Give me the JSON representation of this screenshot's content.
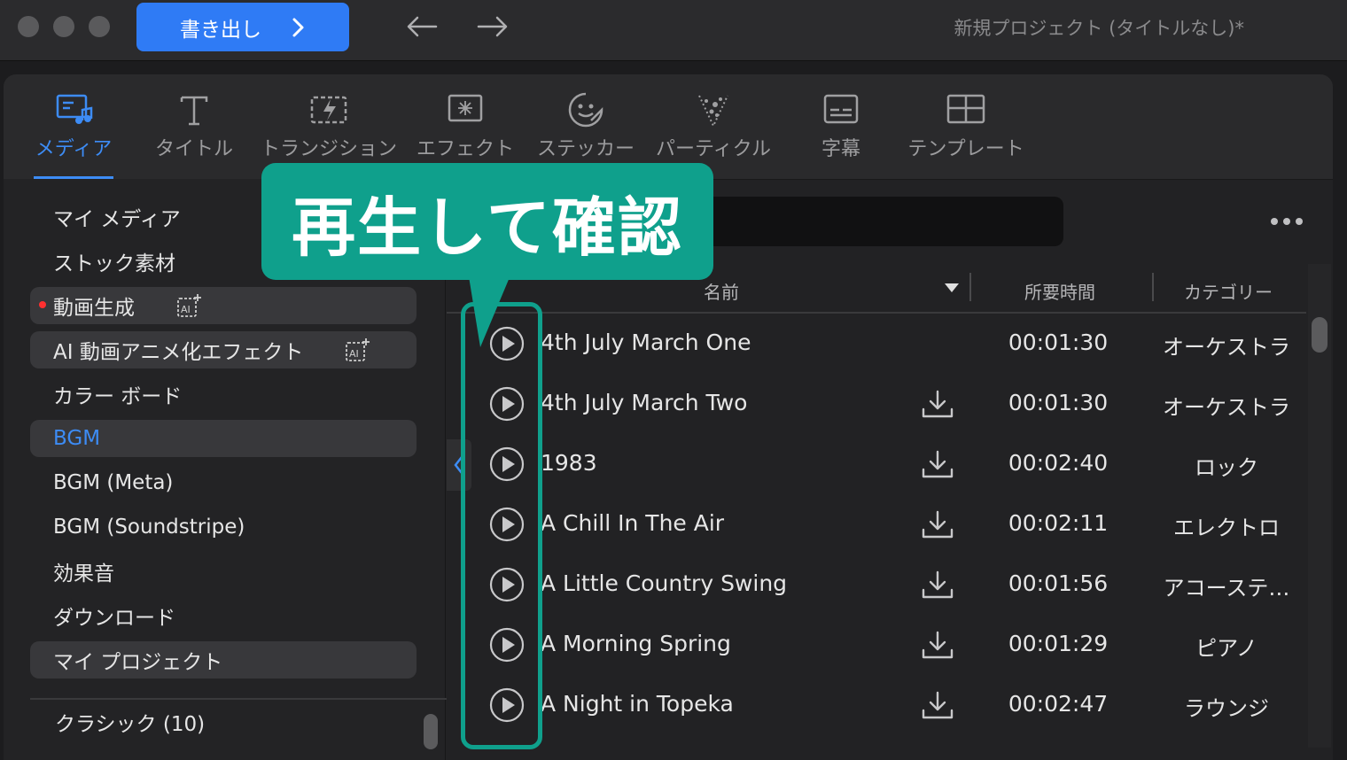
{
  "titlebar": {
    "export_label": "書き出し",
    "project_title": "新規プロジェクト (タイトルなし)*"
  },
  "toolbar": {
    "tabs": [
      {
        "label": "メディア",
        "icon": "media-icon",
        "active": true
      },
      {
        "label": "タイトル",
        "icon": "title-icon"
      },
      {
        "label": "トランジション",
        "icon": "transition-icon"
      },
      {
        "label": "エフェクト",
        "icon": "effect-icon"
      },
      {
        "label": "ステッカー",
        "icon": "sticker-icon"
      },
      {
        "label": "パーティクル",
        "icon": "particle-icon"
      },
      {
        "label": "字幕",
        "icon": "subtitle-icon"
      },
      {
        "label": "テンプレート",
        "icon": "template-icon"
      }
    ],
    "accent_color": "#3d8cf5"
  },
  "sidebar": {
    "items": [
      {
        "label": "マイ メディア"
      },
      {
        "label": "ストック素材"
      },
      {
        "label": "動画生成",
        "badge": "AI",
        "new_dot": true
      },
      {
        "label": "AI 動画アニメ化エフェクト",
        "badge": "AI"
      },
      {
        "label": "カラー ボード"
      },
      {
        "label": "BGM",
        "selected": true
      },
      {
        "label": "BGM (Meta)"
      },
      {
        "label": "BGM (Soundstripe)"
      },
      {
        "label": "効果音"
      },
      {
        "label": "ダウンロード"
      },
      {
        "label": "マイ プロジェクト"
      }
    ],
    "category": "クラシック (10)"
  },
  "table": {
    "columns": {
      "name": "名前",
      "duration": "所要時間",
      "category": "カテゴリー"
    },
    "rows": [
      {
        "name": "4th July March One",
        "duration": "00:01:30",
        "category": "オーケストラ",
        "downloaded": true
      },
      {
        "name": "4th July March Two",
        "duration": "00:01:30",
        "category": "オーケストラ"
      },
      {
        "name": "1983",
        "duration": "00:02:40",
        "category": "ロック"
      },
      {
        "name": "A Chill In The Air",
        "duration": "00:02:11",
        "category": "エレクトロ"
      },
      {
        "name": "A Little Country Swing",
        "duration": "00:01:56",
        "category": "アコーステ…"
      },
      {
        "name": "A Morning Spring",
        "duration": "00:01:29",
        "category": "ピアノ"
      },
      {
        "name": "A Night in Topeka",
        "duration": "00:02:47",
        "category": "ラウンジ"
      }
    ]
  },
  "annotation": {
    "callout_text": "再生して確認",
    "color": "#0fa08c"
  }
}
